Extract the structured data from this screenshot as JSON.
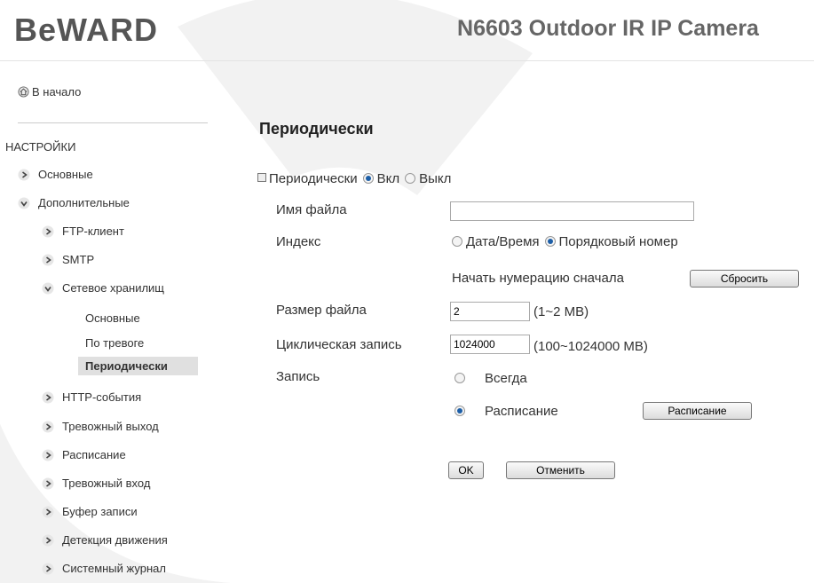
{
  "header": {
    "logo": "BeWARD",
    "camera_title": "N6603 Outdoor IR IP Camera"
  },
  "sidebar": {
    "home_label": "В начало",
    "section_title": "НАСТРОЙКИ",
    "items": [
      {
        "label": "Основные"
      },
      {
        "label": "Дополнительные"
      },
      {
        "label": "FTP-клиент"
      },
      {
        "label": "SMTP"
      },
      {
        "label": "Сетевое хранилищ"
      },
      {
        "label": "Основные"
      },
      {
        "label": "По тревоге"
      },
      {
        "label": "Периодически"
      },
      {
        "label": "HTTP-события"
      },
      {
        "label": "Тревожный выход"
      },
      {
        "label": "Расписание"
      },
      {
        "label": "Тревожный вход"
      },
      {
        "label": "Буфер записи"
      },
      {
        "label": "Детекция движения"
      },
      {
        "label": "Системный журнал"
      }
    ]
  },
  "main": {
    "title": "Периодически",
    "periodic": {
      "label": "Периодически",
      "on": "Вкл",
      "off": "Выкл",
      "selected": "on"
    },
    "filename": {
      "label": "Имя файла",
      "value": ""
    },
    "index": {
      "label": "Индекс",
      "opt_datetime": "Дата/Время",
      "opt_serial": "Порядковый номер",
      "selected": "serial"
    },
    "restart": {
      "label": "Начать нумерацию сначала",
      "button": "Сбросить"
    },
    "filesize": {
      "label": "Размер файла",
      "value": "2",
      "hint": "(1~2 MB)"
    },
    "cyclic": {
      "label": "Циклическая запись",
      "value": "1024000",
      "hint": "(100~1024000 MB)"
    },
    "record": {
      "label": "Запись",
      "opt_always": "Всегда",
      "opt_schedule": "Расписание",
      "schedule_button": "Расписание",
      "selected": "schedule"
    },
    "ok_button": "OK",
    "cancel_button": "Отменить"
  }
}
